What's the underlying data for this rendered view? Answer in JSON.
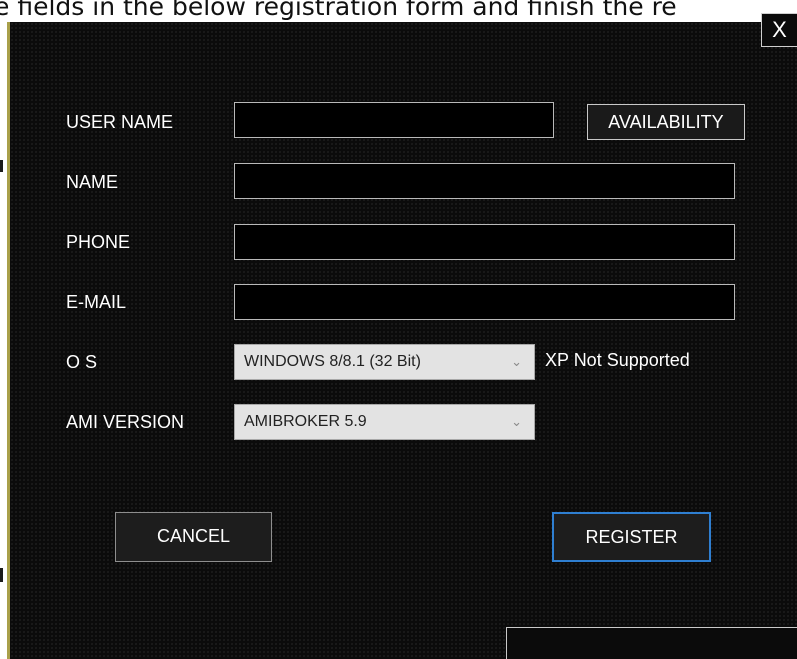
{
  "background_caption": "e fields in the below registration form and finish the re",
  "dialog": {
    "close_label": "X",
    "fields": {
      "username": {
        "label": "USER NAME",
        "value": ""
      },
      "name": {
        "label": "NAME",
        "value": ""
      },
      "phone": {
        "label": "PHONE",
        "value": ""
      },
      "email": {
        "label": "E-MAIL",
        "value": ""
      }
    },
    "availability_label": "AVAILABILITY",
    "os": {
      "label": "O S",
      "selected": "WINDOWS 8/8.1 (32 Bit)",
      "note": "XP Not Supported"
    },
    "ami": {
      "label": "AMI VERSION",
      "selected": "AMIBROKER 5.9"
    },
    "cancel_label": "CANCEL",
    "register_label": "REGISTER"
  },
  "colors": {
    "dialog_bg": "#0b0b0b",
    "register_border": "#2f7fd1",
    "window_edge": "#a9a04a"
  },
  "icons": {
    "close": "close-icon",
    "dropdown": "chevron-down-icon"
  }
}
